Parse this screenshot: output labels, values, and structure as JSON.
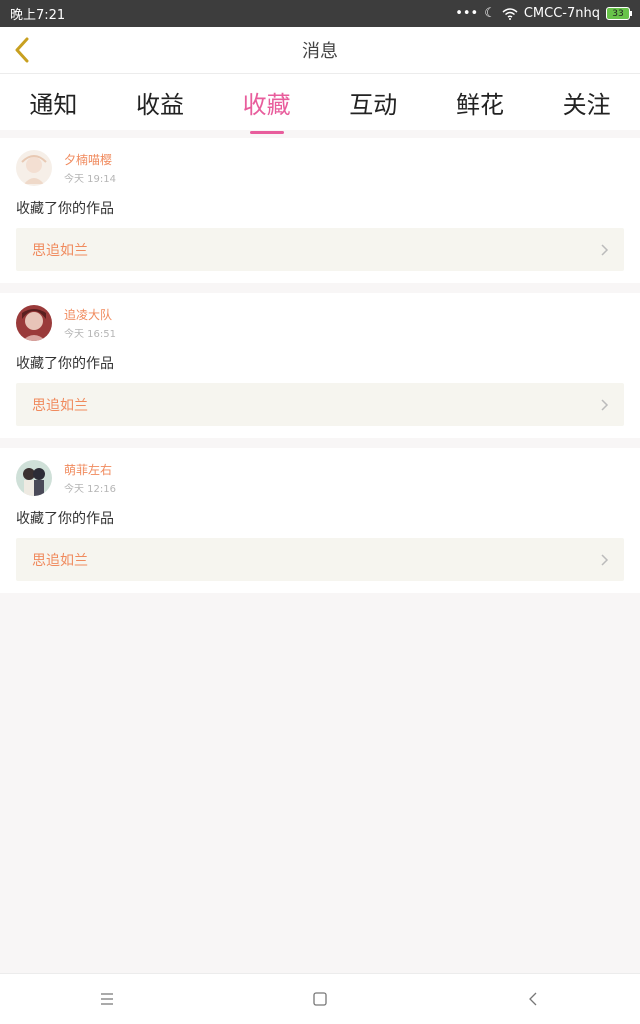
{
  "status_bar": {
    "time": "晚上7:21",
    "carrier": "CMCC-7nhq",
    "battery": "33"
  },
  "header": {
    "title": "消息",
    "back_icon": "chevron-left-icon"
  },
  "tabs": [
    {
      "label": "通知"
    },
    {
      "label": "收益"
    },
    {
      "label": "收藏",
      "active": true
    },
    {
      "label": "互动"
    },
    {
      "label": "鲜花"
    },
    {
      "label": "关注"
    }
  ],
  "notifications": [
    {
      "user": "夕楠喵樱",
      "time": "今天 19:14",
      "action": "收藏了你的作品",
      "work": "思追如兰"
    },
    {
      "user": "追凌大队",
      "time": "今天 16:51",
      "action": "收藏了你的作品",
      "work": "思追如兰"
    },
    {
      "user": "萌菲左右",
      "time": "今天 12:16",
      "action": "收藏了你的作品",
      "work": "思追如兰"
    }
  ],
  "colors": {
    "accent": "#e85d9c",
    "username": "#f08a5d",
    "back_arrow": "#c8a020"
  }
}
